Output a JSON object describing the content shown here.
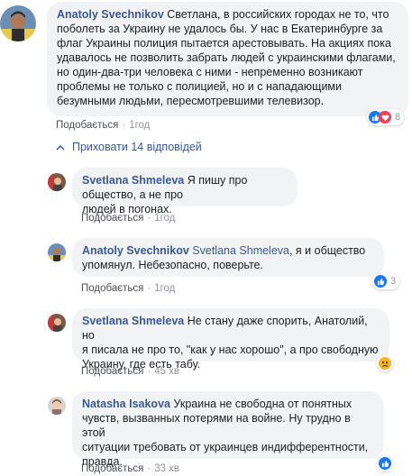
{
  "comments": [
    {
      "author": "Anatoly Svechnikov",
      "text": "Светлана, в российских городах не то, что\nпоболеть за Украину не удалось бы. У нас в Екатеринбурге за\nфлаг Украины полиция пытается арестовывать. На акциях пока\nудавалось не позволить забрать людей с украинскими флагами,\nно один-два-три человека с ними - непременно возникают\nпроблемы не только с полицией, но и с нападающими\nбезумными людьми, пересмотревшими телевизор.",
      "like_label": "Подобається",
      "time": "1год",
      "reaction_count": "8"
    }
  ],
  "replies_toggle": "Приховати 14 відповідей",
  "replies": [
    {
      "author": "Svetlana Shmeleva",
      "text": "Я пишу про общество, а не про\nлюдей в погонах.",
      "like_label": "Подобається",
      "time": "1год"
    },
    {
      "author": "Anatoly Svechnikov",
      "mention": "Svetlana Shmeleva",
      "text": ", я и общество\nупомянул. Небезопасно, поверьте.",
      "like_label": "Подобається",
      "time": "1год",
      "reaction_count": "3"
    },
    {
      "author": "Svetlana Shmeleva",
      "text": "Не стану даже спорить, Анатолий, но\nя писала не про то, \"как у нас хорошо\", а про свободную\nУкраину, где есть табу.",
      "like_label": "Подобається",
      "time": "45 хв"
    },
    {
      "author": "Natasha Isakova",
      "text": "Украина не свободна от понятных\nчувств, вызванных потерями на войне. Ну трудно в этой\nситуации требовать от украинцев индифферентности,\nправда.",
      "like_label": "Подобається",
      "time": "33 хв"
    }
  ],
  "colors": {
    "link": "#385898",
    "bubble": "#f2f3f5",
    "meta": "#90949c",
    "like_blue": "#1877f2",
    "love_red": "#f33e58",
    "haha_yellow": "#f7b125"
  },
  "icons": [
    "like-reaction-icon",
    "love-reaction-icon",
    "sad-reaction-icon",
    "chevron-up-icon"
  ]
}
